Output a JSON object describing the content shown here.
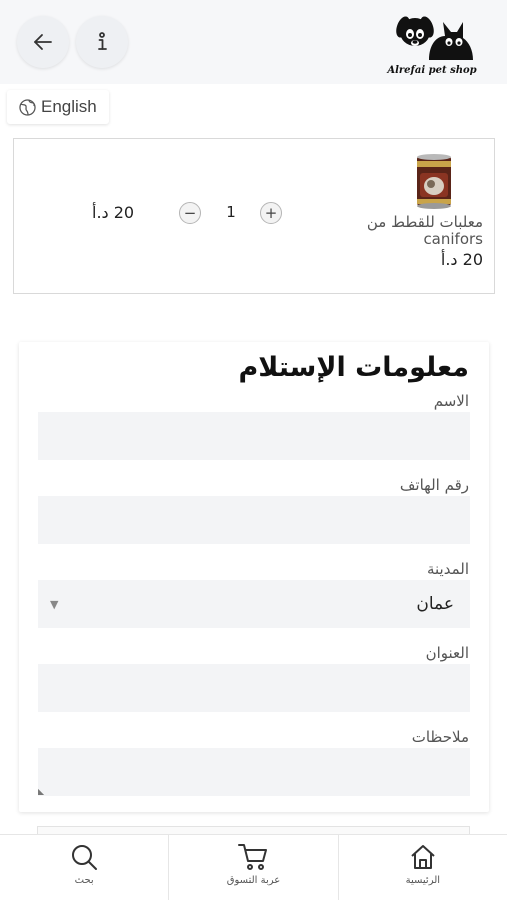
{
  "header": {
    "logo_text": "Alrefai pet shop",
    "icons": {
      "back": "arrow-left-icon",
      "info": "info-icon",
      "logo": "dog-cat-logo"
    }
  },
  "language_button": {
    "label": "English",
    "icon": "globe-icon"
  },
  "cart_item": {
    "name": "معلبات للقطط من canifors",
    "price": "20 د.أ",
    "quantity": "1",
    "line_total": "20 د.أ",
    "minus_symbol": "−",
    "plus_symbol": "+",
    "image_icon": "cat-food-can"
  },
  "form": {
    "title": "معلومات الإستلام",
    "fields": [
      {
        "label": "الاسم",
        "value": ""
      },
      {
        "label": "رقم الهاتف",
        "value": ""
      },
      {
        "label": "المدينة",
        "value": "عمان",
        "type": "select"
      },
      {
        "label": "العنوان",
        "value": ""
      },
      {
        "label": "ملاحظات",
        "value": "",
        "type": "textarea"
      }
    ]
  },
  "bottom_nav": {
    "items": [
      {
        "label": "بحث",
        "icon": "search-icon"
      },
      {
        "label": "عربة التسوق",
        "icon": "cart-icon"
      },
      {
        "label": "الرئيسية",
        "icon": "home-icon"
      }
    ]
  },
  "colors": {
    "header_bg": "#f6f7f9",
    "field_bg": "#f3f4f6",
    "text": "#222222",
    "border": "#d9d9d9"
  }
}
